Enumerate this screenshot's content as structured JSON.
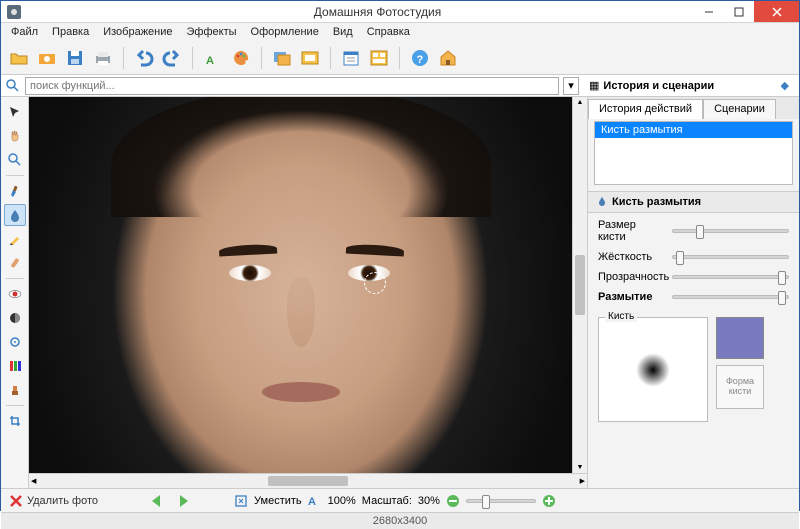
{
  "window": {
    "title": "Домашняя Фотостудия"
  },
  "menu": [
    "Файл",
    "Правка",
    "Изображение",
    "Эффекты",
    "Оформление",
    "Вид",
    "Справка"
  ],
  "search": {
    "placeholder": "поиск функций..."
  },
  "rightpanel": {
    "title": "История и сценарии",
    "tabs": [
      "История действий",
      "Сценарии"
    ],
    "history": [
      "Кисть размытия"
    ],
    "group_title": "Кисть размытия",
    "sliders": {
      "size": {
        "label": "Размер кисти",
        "pos": 20
      },
      "hardness": {
        "label": "Жёсткость",
        "pos": 5
      },
      "opacity": {
        "label": "Прозрачность",
        "pos": 98
      },
      "blur": {
        "label": "Размытие",
        "pos": 98
      }
    },
    "brush_label": "Кисть",
    "shape_btn": "Форма кисти"
  },
  "bottombar": {
    "delete": "Удалить фото",
    "fit": "Уместить",
    "hundred": "100%",
    "scale_label": "Масштаб:",
    "scale_value": "30%"
  },
  "status": {
    "dims": "2680x3400"
  }
}
